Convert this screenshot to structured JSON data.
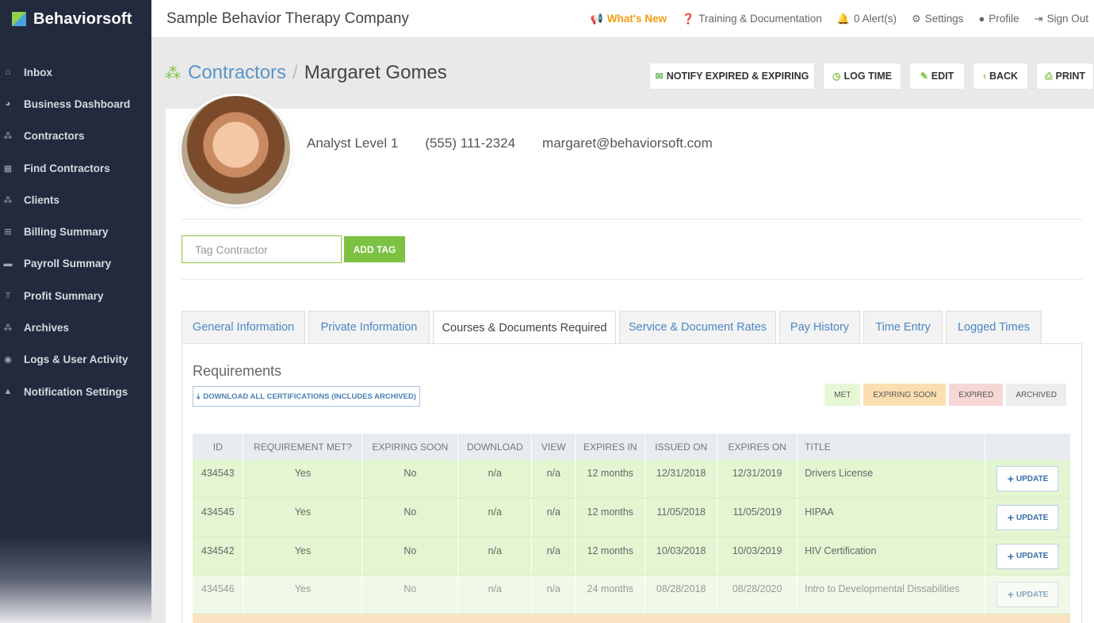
{
  "brand": {
    "name": "Behaviorsoft"
  },
  "sidebar": {
    "items": [
      {
        "label": "Inbox",
        "icon": "home-icon",
        "glyph": "⌂"
      },
      {
        "label": "Business Dashboard",
        "icon": "pie-chart-icon",
        "glyph": "◕"
      },
      {
        "label": "Contractors",
        "icon": "users-icon",
        "glyph": "⁂"
      },
      {
        "label": "Find Contractors",
        "icon": "map-icon",
        "glyph": "▦"
      },
      {
        "label": "Clients",
        "icon": "users-icon",
        "glyph": "⁂"
      },
      {
        "label": "Billing Summary",
        "icon": "table-icon",
        "glyph": "⊞"
      },
      {
        "label": "Payroll Summary",
        "icon": "money-icon",
        "glyph": "▬"
      },
      {
        "label": "Profit Summary",
        "icon": "bank-icon",
        "glyph": "⫪"
      },
      {
        "label": "Archives",
        "icon": "users-icon",
        "glyph": "⁂"
      },
      {
        "label": "Logs & User Activity",
        "icon": "eye-icon",
        "glyph": "◉"
      },
      {
        "label": "Notification Settings",
        "icon": "warning-icon",
        "glyph": "▲"
      }
    ]
  },
  "topbar": {
    "company": "Sample Behavior Therapy Company",
    "whats_new": "What's New",
    "training": "Training & Documentation",
    "alerts": "0 Alert(s)",
    "settings": "Settings",
    "profile": "Profile",
    "signout": "Sign Out"
  },
  "header": {
    "root": "Contractors",
    "separator": "/",
    "name": "Margaret Gomes",
    "buttons": {
      "notify": "NOTIFY EXPIRED & EXPIRING",
      "log_time": "LOG TIME",
      "edit": "EDIT",
      "back": "BACK",
      "print": "PRINT"
    }
  },
  "profile": {
    "level": "Analyst Level 1",
    "phone": "(555) 111-2324",
    "email": "margaret@behaviorsoft.com"
  },
  "tag": {
    "placeholder": "Tag Contractor",
    "button": "ADD TAG"
  },
  "tabs": [
    {
      "label": "General Information",
      "active": false
    },
    {
      "label": "Private Information",
      "active": false
    },
    {
      "label": "Courses & Documents Required",
      "active": true
    },
    {
      "label": "Service & Document Rates",
      "active": false
    },
    {
      "label": "Pay History",
      "active": false
    },
    {
      "label": "Time Entry",
      "active": false
    },
    {
      "label": "Logged Times",
      "active": false
    }
  ],
  "requirements": {
    "title": "Requirements",
    "download_all": "DOWNLOAD ALL CERTIFICATIONS (INCLUDES ARCHIVED)",
    "legend": {
      "met": "MET",
      "expiring_soon": "EXPIRING SOON",
      "expired": "EXPIRED",
      "archived": "ARCHIVED"
    },
    "columns": [
      "ID",
      "REQUIREMENT MET?",
      "EXPIRING SOON",
      "DOWNLOAD",
      "VIEW",
      "EXPIRES IN",
      "ISSUED ON",
      "EXPIRES ON",
      "TITLE",
      ""
    ],
    "update_label": "UPDATE",
    "rows": [
      {
        "id": "434543",
        "met": "Yes",
        "soon": "No",
        "download": "n/a",
        "view": "n/a",
        "expires_in": "12 months",
        "issued": "12/31/2018",
        "expires": "12/31/2019",
        "title": "Drivers License"
      },
      {
        "id": "434545",
        "met": "Yes",
        "soon": "No",
        "download": "n/a",
        "view": "n/a",
        "expires_in": "12 months",
        "issued": "11/05/2018",
        "expires": "11/05/2019",
        "title": "HIPAA"
      },
      {
        "id": "434542",
        "met": "Yes",
        "soon": "No",
        "download": "n/a",
        "view": "n/a",
        "expires_in": "12 months",
        "issued": "10/03/2018",
        "expires": "10/03/2019",
        "title": "HIV Certification"
      },
      {
        "id": "434546",
        "met": "Yes",
        "soon": "No",
        "download": "n/a",
        "view": "n/a",
        "expires_in": "24 months",
        "issued": "08/28/2018",
        "expires": "08/28/2020",
        "title": "Intro to Developmental Dissabilities"
      }
    ]
  },
  "colors": {
    "sidebar_bg": "#222a3d",
    "accent_green": "#7cc142",
    "link_blue": "#4a86c5",
    "whats_new": "#f39c12"
  }
}
